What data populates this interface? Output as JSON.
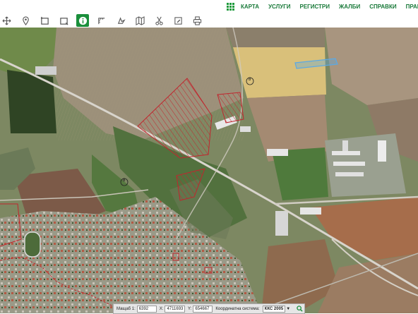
{
  "nav": {
    "items": [
      "КАРТА",
      "УСЛУГИ",
      "РЕГИСТРИ",
      "ЖАЛБИ",
      "СПРАВКИ",
      "ПРАВОСПО"
    ]
  },
  "toolbar": {
    "tools": [
      "pan-icon",
      "pin-icon",
      "select-rect-icon",
      "select-rect-plus-icon",
      "info-icon",
      "measure-icon",
      "pointer-icon",
      "map-icon",
      "scissors-icon",
      "edit-icon",
      "print-icon"
    ]
  },
  "map": {
    "labels": [
      "8",
      "8"
    ]
  },
  "status": {
    "scale_label": "Мащаб 1:",
    "scale_value": "6392",
    "x_label": "X:",
    "x_value": "4711693",
    "y_label": "Y:",
    "y_value": "654667",
    "cs_label": "Координатна система:",
    "cs_value": "ККС 2005"
  },
  "colors": {
    "accent": "#1a8f3b",
    "parcel_outline": "#c0262e",
    "highlight_parcel": "#5aa9e6"
  }
}
